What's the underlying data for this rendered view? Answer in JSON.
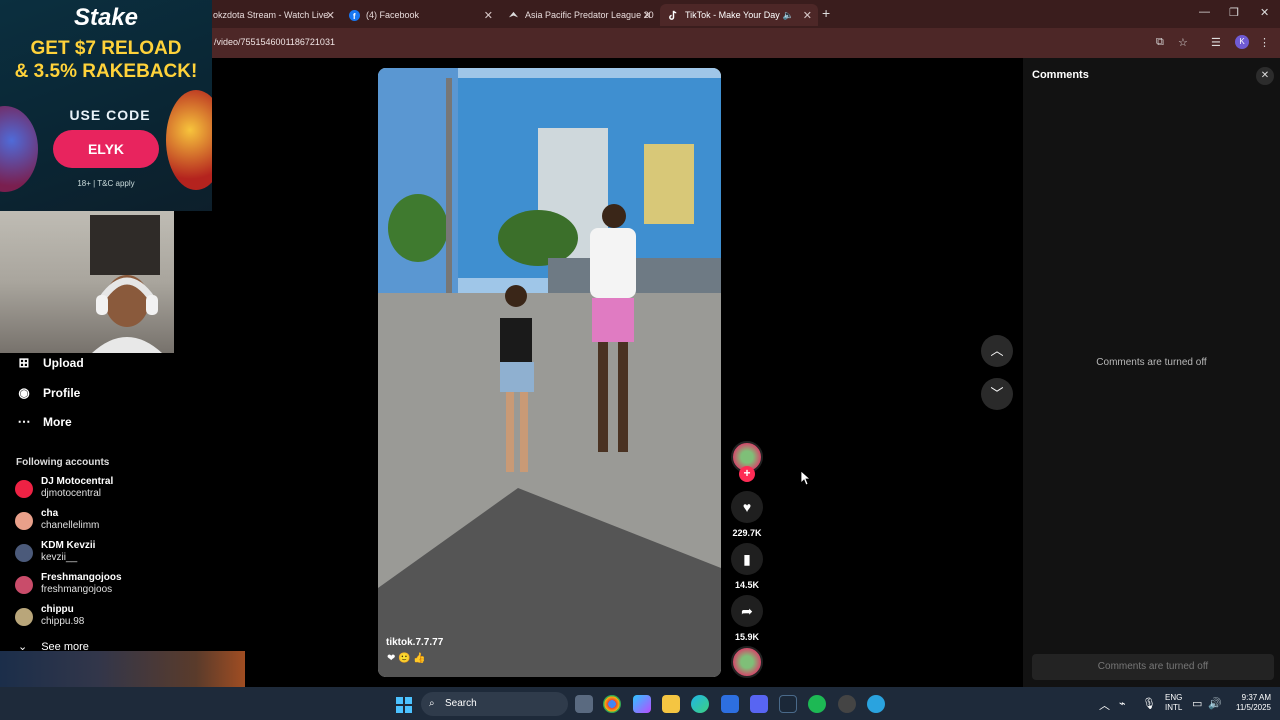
{
  "browser": {
    "tabs": [
      {
        "title": "okzdota Stream - Watch Live"
      },
      {
        "title": "(4) Facebook"
      },
      {
        "title": "Asia Pacific Predator League 20"
      },
      {
        "title": "TikTok - Make Your Day"
      }
    ],
    "new_tab_label": "+",
    "url": "/video/7551546001186721031",
    "profile_initial": "K"
  },
  "ad": {
    "brand": "Stake",
    "line1": "GET $7 RELOAD",
    "line2": "& 3.5% RAKEBACK!",
    "code_label": "USE CODE",
    "code": "ELYK",
    "fine_print": "18+ | T&C apply"
  },
  "sidebar": {
    "items": [
      {
        "label": "Upload",
        "icon": "upload-icon"
      },
      {
        "label": "Profile",
        "icon": "profile-icon"
      },
      {
        "label": "More",
        "icon": "more-icon"
      }
    ],
    "following_title": "Following accounts",
    "accounts": [
      {
        "name": "DJ Motocentral",
        "handle": "djmotocentral"
      },
      {
        "name": "cha",
        "handle": "chanellelimm"
      },
      {
        "name": "KDM Kevzii",
        "handle": "kevzii__"
      },
      {
        "name": "Freshmangojoos",
        "handle": "freshmangojoos"
      },
      {
        "name": "chippu",
        "handle": "chippu.98"
      }
    ],
    "see_more": "See more"
  },
  "video": {
    "caption": "tiktok.7.7.77",
    "emojis": "❤ 🙂 👍"
  },
  "actions": {
    "likes": "229.7K",
    "saves": "14.5K",
    "shares": "15.9K"
  },
  "comments": {
    "title": "Comments",
    "off_message": "Comments are turned off",
    "input_placeholder": "Comments are turned off"
  },
  "taskbar": {
    "search_label": "Search",
    "lang_line1": "ENG",
    "lang_line2": "INTL",
    "time": "9:37 AM",
    "date": "11/5/2025"
  },
  "colors": {
    "accent": "#fe2c55",
    "tabbar": "#3a1d1d",
    "addressbar": "#4d2727"
  }
}
